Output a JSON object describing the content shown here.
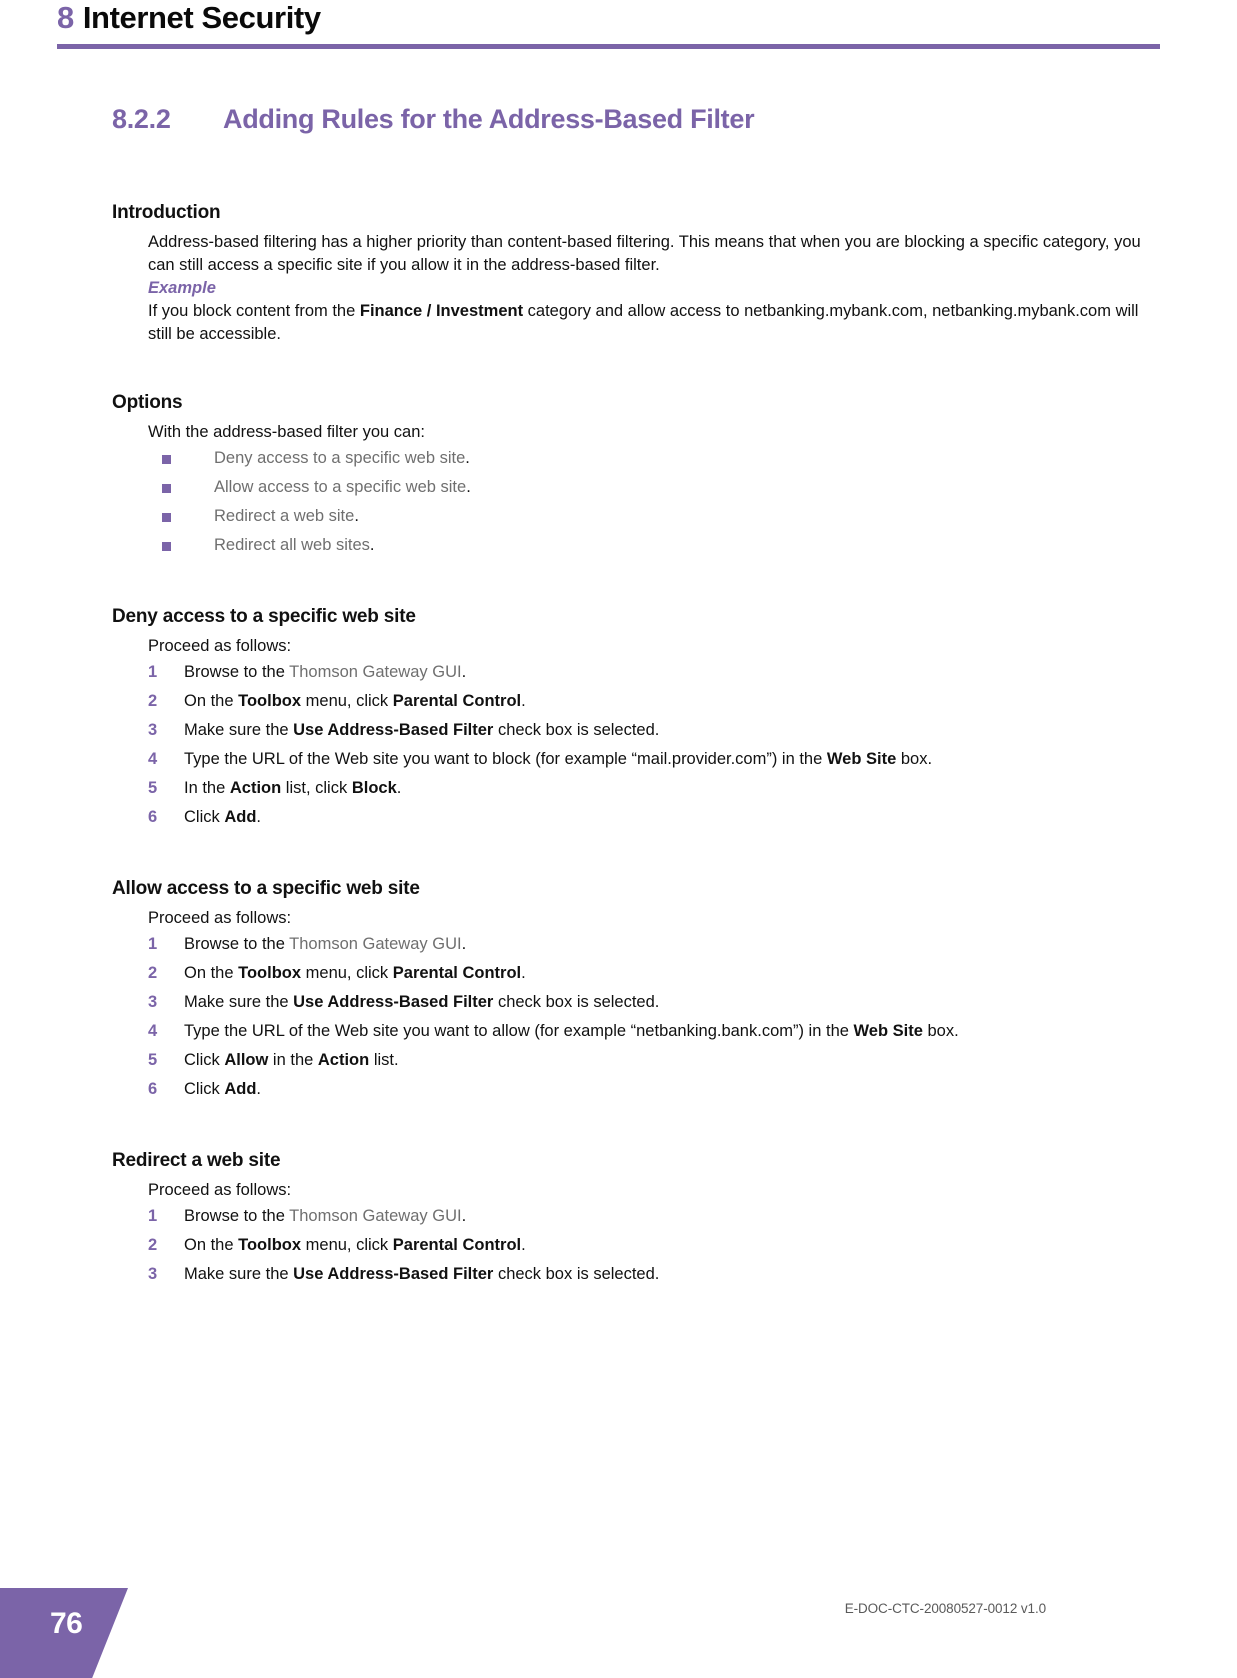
{
  "header": {
    "chapter_number": "8",
    "chapter_name": "Internet Security"
  },
  "section": {
    "number": "8.2.2",
    "title": "Adding Rules for the Address-Based Filter"
  },
  "introduction": {
    "heading": "Introduction",
    "paragraph": "Address-based filtering has a higher priority than content-based filtering. This means that when you are blocking a specific category, you can still access a specific site if you allow it in the address-based filter.",
    "example_label": "Example",
    "example_prefix": "If you block content from the ",
    "example_bold": "Finance / Investment",
    "example_suffix": " category and allow access to netbanking.mybank.com, netbanking.mybank.com will still be accessible."
  },
  "options": {
    "heading": "Options",
    "lead": "With the address-based filter you can:",
    "items": [
      {
        "xref": "Deny access to a specific web site",
        "tail": "."
      },
      {
        "xref": "Allow access to a specific web site",
        "tail": "."
      },
      {
        "xref": "Redirect a web site",
        "tail": "."
      },
      {
        "xref": "Redirect all web sites",
        "tail": "."
      }
    ]
  },
  "procedures": [
    {
      "heading": "Deny access to a specific web site",
      "lead": "Proceed as follows:",
      "steps": [
        {
          "number": "1",
          "parts": [
            {
              "t": "Browse to the ",
              "s": "plain"
            },
            {
              "t": "Thomson Gateway GUI",
              "s": "xref"
            },
            {
              "t": ".",
              "s": "plain"
            }
          ]
        },
        {
          "number": "2",
          "parts": [
            {
              "t": "On the ",
              "s": "plain"
            },
            {
              "t": "Toolbox",
              "s": "bold"
            },
            {
              "t": " menu, click ",
              "s": "plain"
            },
            {
              "t": "Parental Control",
              "s": "bold"
            },
            {
              "t": ".",
              "s": "plain"
            }
          ]
        },
        {
          "number": "3",
          "parts": [
            {
              "t": "Make sure the ",
              "s": "plain"
            },
            {
              "t": "Use Address-Based Filter",
              "s": "bold"
            },
            {
              "t": " check box is selected.",
              "s": "plain"
            }
          ]
        },
        {
          "number": "4",
          "parts": [
            {
              "t": "Type the URL of the Web site you want to block (for example “mail.provider.com”) in the ",
              "s": "plain"
            },
            {
              "t": "Web Site",
              "s": "bold"
            },
            {
              "t": " box.",
              "s": "plain"
            }
          ]
        },
        {
          "number": "5",
          "parts": [
            {
              "t": "In the ",
              "s": "plain"
            },
            {
              "t": "Action",
              "s": "bold"
            },
            {
              "t": " list, click ",
              "s": "plain"
            },
            {
              "t": "Block",
              "s": "bold"
            },
            {
              "t": ".",
              "s": "plain"
            }
          ]
        },
        {
          "number": "6",
          "parts": [
            {
              "t": "Click ",
              "s": "plain"
            },
            {
              "t": "Add",
              "s": "bold"
            },
            {
              "t": ".",
              "s": "plain"
            }
          ]
        }
      ]
    },
    {
      "heading": "Allow access to a specific web site",
      "lead": "Proceed as follows:",
      "steps": [
        {
          "number": "1",
          "parts": [
            {
              "t": "Browse to the ",
              "s": "plain"
            },
            {
              "t": "Thomson Gateway GUI",
              "s": "xref"
            },
            {
              "t": ".",
              "s": "plain"
            }
          ]
        },
        {
          "number": "2",
          "parts": [
            {
              "t": "On the ",
              "s": "plain"
            },
            {
              "t": "Toolbox",
              "s": "bold"
            },
            {
              "t": " menu, click ",
              "s": "plain"
            },
            {
              "t": "Parental Control",
              "s": "bold"
            },
            {
              "t": ".",
              "s": "plain"
            }
          ]
        },
        {
          "number": "3",
          "parts": [
            {
              "t": "Make sure the ",
              "s": "plain"
            },
            {
              "t": "Use Address-Based Filter",
              "s": "bold"
            },
            {
              "t": " check box is selected.",
              "s": "plain"
            }
          ]
        },
        {
          "number": "4",
          "parts": [
            {
              "t": "Type the URL of the Web site you want to allow (for example “netbanking.bank.com”) in the ",
              "s": "plain"
            },
            {
              "t": "Web Site",
              "s": "bold"
            },
            {
              "t": " box.",
              "s": "plain"
            }
          ]
        },
        {
          "number": "5",
          "parts": [
            {
              "t": "Click ",
              "s": "plain"
            },
            {
              "t": "Allow",
              "s": "bold"
            },
            {
              "t": " in the ",
              "s": "plain"
            },
            {
              "t": "Action",
              "s": "bold"
            },
            {
              "t": " list.",
              "s": "plain"
            }
          ]
        },
        {
          "number": "6",
          "parts": [
            {
              "t": "Click ",
              "s": "plain"
            },
            {
              "t": "Add",
              "s": "bold"
            },
            {
              "t": ".",
              "s": "plain"
            }
          ]
        }
      ]
    },
    {
      "heading": "Redirect a web site",
      "lead": "Proceed as follows:",
      "steps": [
        {
          "number": "1",
          "parts": [
            {
              "t": "Browse to the ",
              "s": "plain"
            },
            {
              "t": "Thomson Gateway GUI",
              "s": "xref"
            },
            {
              "t": ".",
              "s": "plain"
            }
          ]
        },
        {
          "number": "2",
          "parts": [
            {
              "t": "On the ",
              "s": "plain"
            },
            {
              "t": "Toolbox",
              "s": "bold"
            },
            {
              "t": " menu, click ",
              "s": "plain"
            },
            {
              "t": "Parental Control",
              "s": "bold"
            },
            {
              "t": ".",
              "s": "plain"
            }
          ]
        },
        {
          "number": "3",
          "parts": [
            {
              "t": "Make sure the ",
              "s": "plain"
            },
            {
              "t": "Use Address-Based Filter",
              "s": "bold"
            },
            {
              "t": " check box is selected.",
              "s": "plain"
            }
          ]
        }
      ]
    }
  ],
  "footer": {
    "page_number": "76",
    "doc_code": "E-DOC-CTC-20080527-0012 v1.0"
  },
  "colors": {
    "accent_purple": "#7b64a8",
    "xref_gray": "#6f6f6f",
    "body_black": "#111111"
  }
}
